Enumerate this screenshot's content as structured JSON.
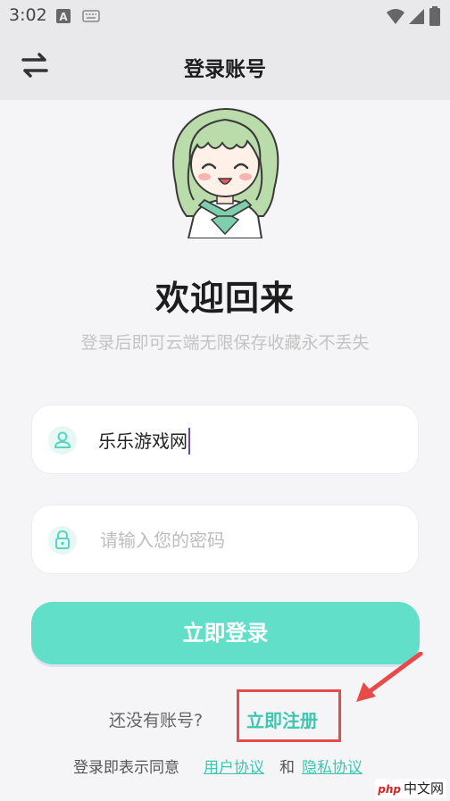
{
  "status_bar": {
    "time": "3:02"
  },
  "header": {
    "title": "登录账号",
    "switch_icon": "swap-arrows-icon"
  },
  "welcome": {
    "title": "欢迎回来",
    "subtitle": "登录后即可云端无限保存收藏永不丢失"
  },
  "form": {
    "username": {
      "value": "乐乐游戏网",
      "icon": "user-icon"
    },
    "password": {
      "placeholder": "请输入您的密码",
      "icon": "lock-icon"
    },
    "login_button": "立即登录"
  },
  "register": {
    "prompt": "还没有账号?",
    "link": "立即注册"
  },
  "agreement": {
    "prefix": "登录即表示同意",
    "user_agreement": "用户协议",
    "and": "和",
    "privacy_policy": "隐私协议"
  },
  "watermark": {
    "brand": "php",
    "text": "中文网"
  },
  "colors": {
    "accent": "#62dfc9",
    "link": "#3cc8b0",
    "highlight": "#e84a4a"
  }
}
